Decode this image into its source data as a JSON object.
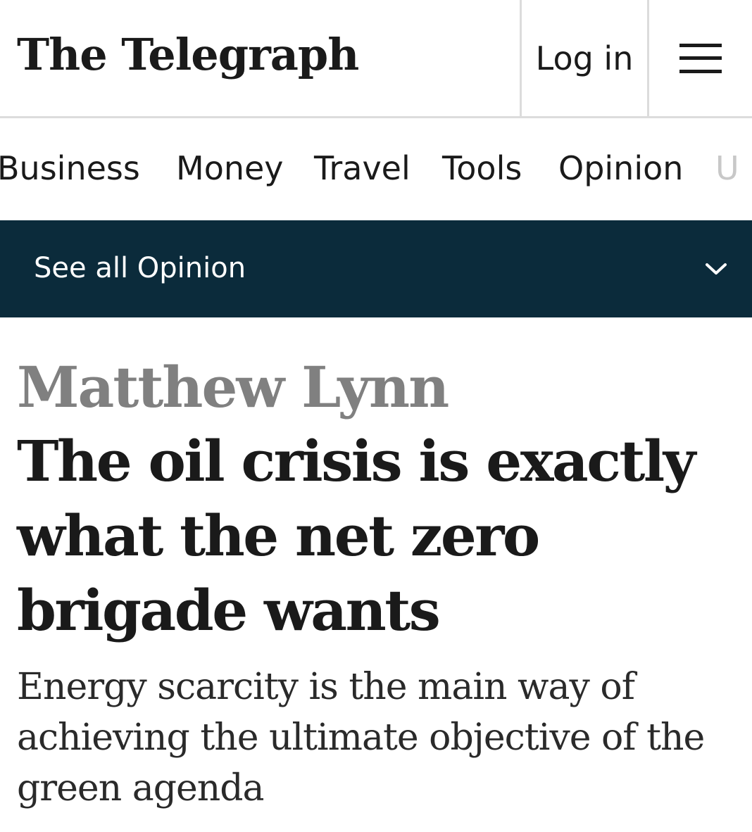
{
  "header": {
    "logo": "The Telegraph",
    "login_label": "Log in",
    "menu_icon": "hamburger-menu-icon"
  },
  "nav": {
    "items": [
      {
        "label": "Business"
      },
      {
        "label": "Money"
      },
      {
        "label": "Travel"
      },
      {
        "label": "Tools"
      },
      {
        "label": "Opinion"
      },
      {
        "label": "U"
      }
    ]
  },
  "section_bar": {
    "label": "See all Opinion",
    "icon": "chevron-down-icon",
    "background": "#0b2b3b"
  },
  "article": {
    "author": "Matthew Lynn",
    "headline": "The oil crisis is exactly what the net zero brigade wants",
    "standfirst": "Energy scarcity is the main way of achieving the ultimate objective of the green agenda"
  }
}
